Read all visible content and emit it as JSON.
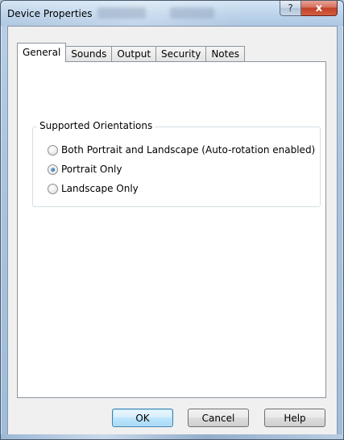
{
  "window": {
    "title": "Device Properties",
    "help_glyph": "?",
    "close_glyph": "x"
  },
  "tabs": [
    {
      "label": "General",
      "active": true
    },
    {
      "label": "Sounds",
      "active": false
    },
    {
      "label": "Output",
      "active": false
    },
    {
      "label": "Security",
      "active": false
    },
    {
      "label": "Notes",
      "active": false
    }
  ],
  "orientation_group": {
    "title": "Supported Orientations",
    "options": [
      {
        "label": "Both Portrait and Landscape (Auto-rotation enabled)",
        "checked": false
      },
      {
        "label": "Portrait Only",
        "checked": true
      },
      {
        "label": "Landscape Only",
        "checked": false
      }
    ]
  },
  "buttons": {
    "ok": "OK",
    "cancel": "Cancel",
    "help": "Help"
  },
  "colors": {
    "accent": "#3c7fb1",
    "close_button": "#c2412a"
  }
}
